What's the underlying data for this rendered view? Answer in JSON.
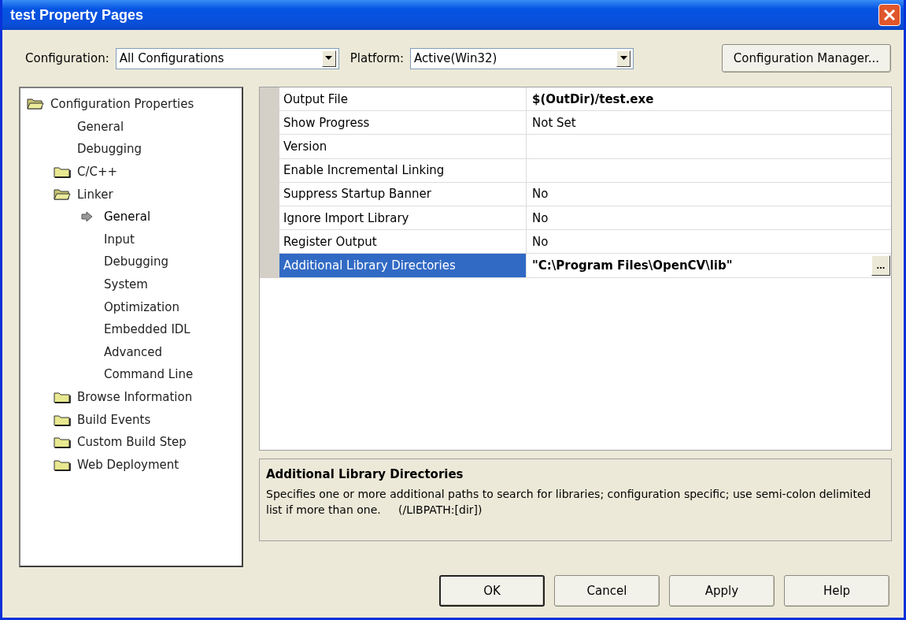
{
  "window": {
    "title": "test Property Pages"
  },
  "toolbar": {
    "configuration": {
      "label": "Configuration:",
      "value": "All Configurations"
    },
    "platform": {
      "label": "Platform:",
      "value": "Active(Win32)"
    },
    "manager_button": "Configuration Manager..."
  },
  "tree": [
    {
      "label": "Configuration Properties",
      "kind": "folder",
      "expanded": true,
      "selected": false,
      "children": [
        {
          "label": "General",
          "kind": "page",
          "selected": false
        },
        {
          "label": "Debugging",
          "kind": "page",
          "selected": false
        },
        {
          "label": "C/C++",
          "kind": "folder",
          "expanded": false,
          "selected": false
        },
        {
          "label": "Linker",
          "kind": "folder",
          "expanded": true,
          "selected": false,
          "children": [
            {
              "label": "General",
              "kind": "page",
              "selected": true
            },
            {
              "label": "Input",
              "kind": "page",
              "selected": false
            },
            {
              "label": "Debugging",
              "kind": "page",
              "selected": false
            },
            {
              "label": "System",
              "kind": "page",
              "selected": false
            },
            {
              "label": "Optimization",
              "kind": "page",
              "selected": false
            },
            {
              "label": "Embedded IDL",
              "kind": "page",
              "selected": false
            },
            {
              "label": "Advanced",
              "kind": "page",
              "selected": false
            },
            {
              "label": "Command Line",
              "kind": "page",
              "selected": false
            }
          ]
        },
        {
          "label": "Browse Information",
          "kind": "folder",
          "expanded": false,
          "selected": false
        },
        {
          "label": "Build Events",
          "kind": "folder",
          "expanded": false,
          "selected": false
        },
        {
          "label": "Custom Build Step",
          "kind": "folder",
          "expanded": false,
          "selected": false
        },
        {
          "label": "Web Deployment",
          "kind": "folder",
          "expanded": false,
          "selected": false
        }
      ]
    }
  ],
  "properties": [
    {
      "name": "Output File",
      "value": "$(OutDir)/test.exe",
      "bold": true,
      "selected": false
    },
    {
      "name": "Show Progress",
      "value": "Not Set",
      "bold": false,
      "selected": false
    },
    {
      "name": "Version",
      "selected": false
    },
    {
      "name": "Enable Incremental Linking",
      "selected": false
    },
    {
      "name": "Suppress Startup Banner",
      "value": "No",
      "bold": false,
      "selected": false
    },
    {
      "name": "Ignore Import Library",
      "value": "No",
      "bold": false,
      "selected": false
    },
    {
      "name": "Register Output",
      "value": "No",
      "bold": false,
      "selected": false
    },
    {
      "name": "Additional Library Directories",
      "value": "\"C:\\Program Files\\OpenCV\\lib\"",
      "bold": true,
      "selected": true,
      "browse_button": "..."
    }
  ],
  "description": {
    "title": "Additional Library Directories",
    "text": "Specifies one or more additional paths to search for libraries; configuration specific; use semi-colon delimited list if more than one.     (/LIBPATH:[dir])"
  },
  "buttons": [
    {
      "label": "OK",
      "default": true
    },
    {
      "label": "Cancel",
      "default": false
    },
    {
      "label": "Apply",
      "default": false
    },
    {
      "label": "Help",
      "default": false
    }
  ]
}
